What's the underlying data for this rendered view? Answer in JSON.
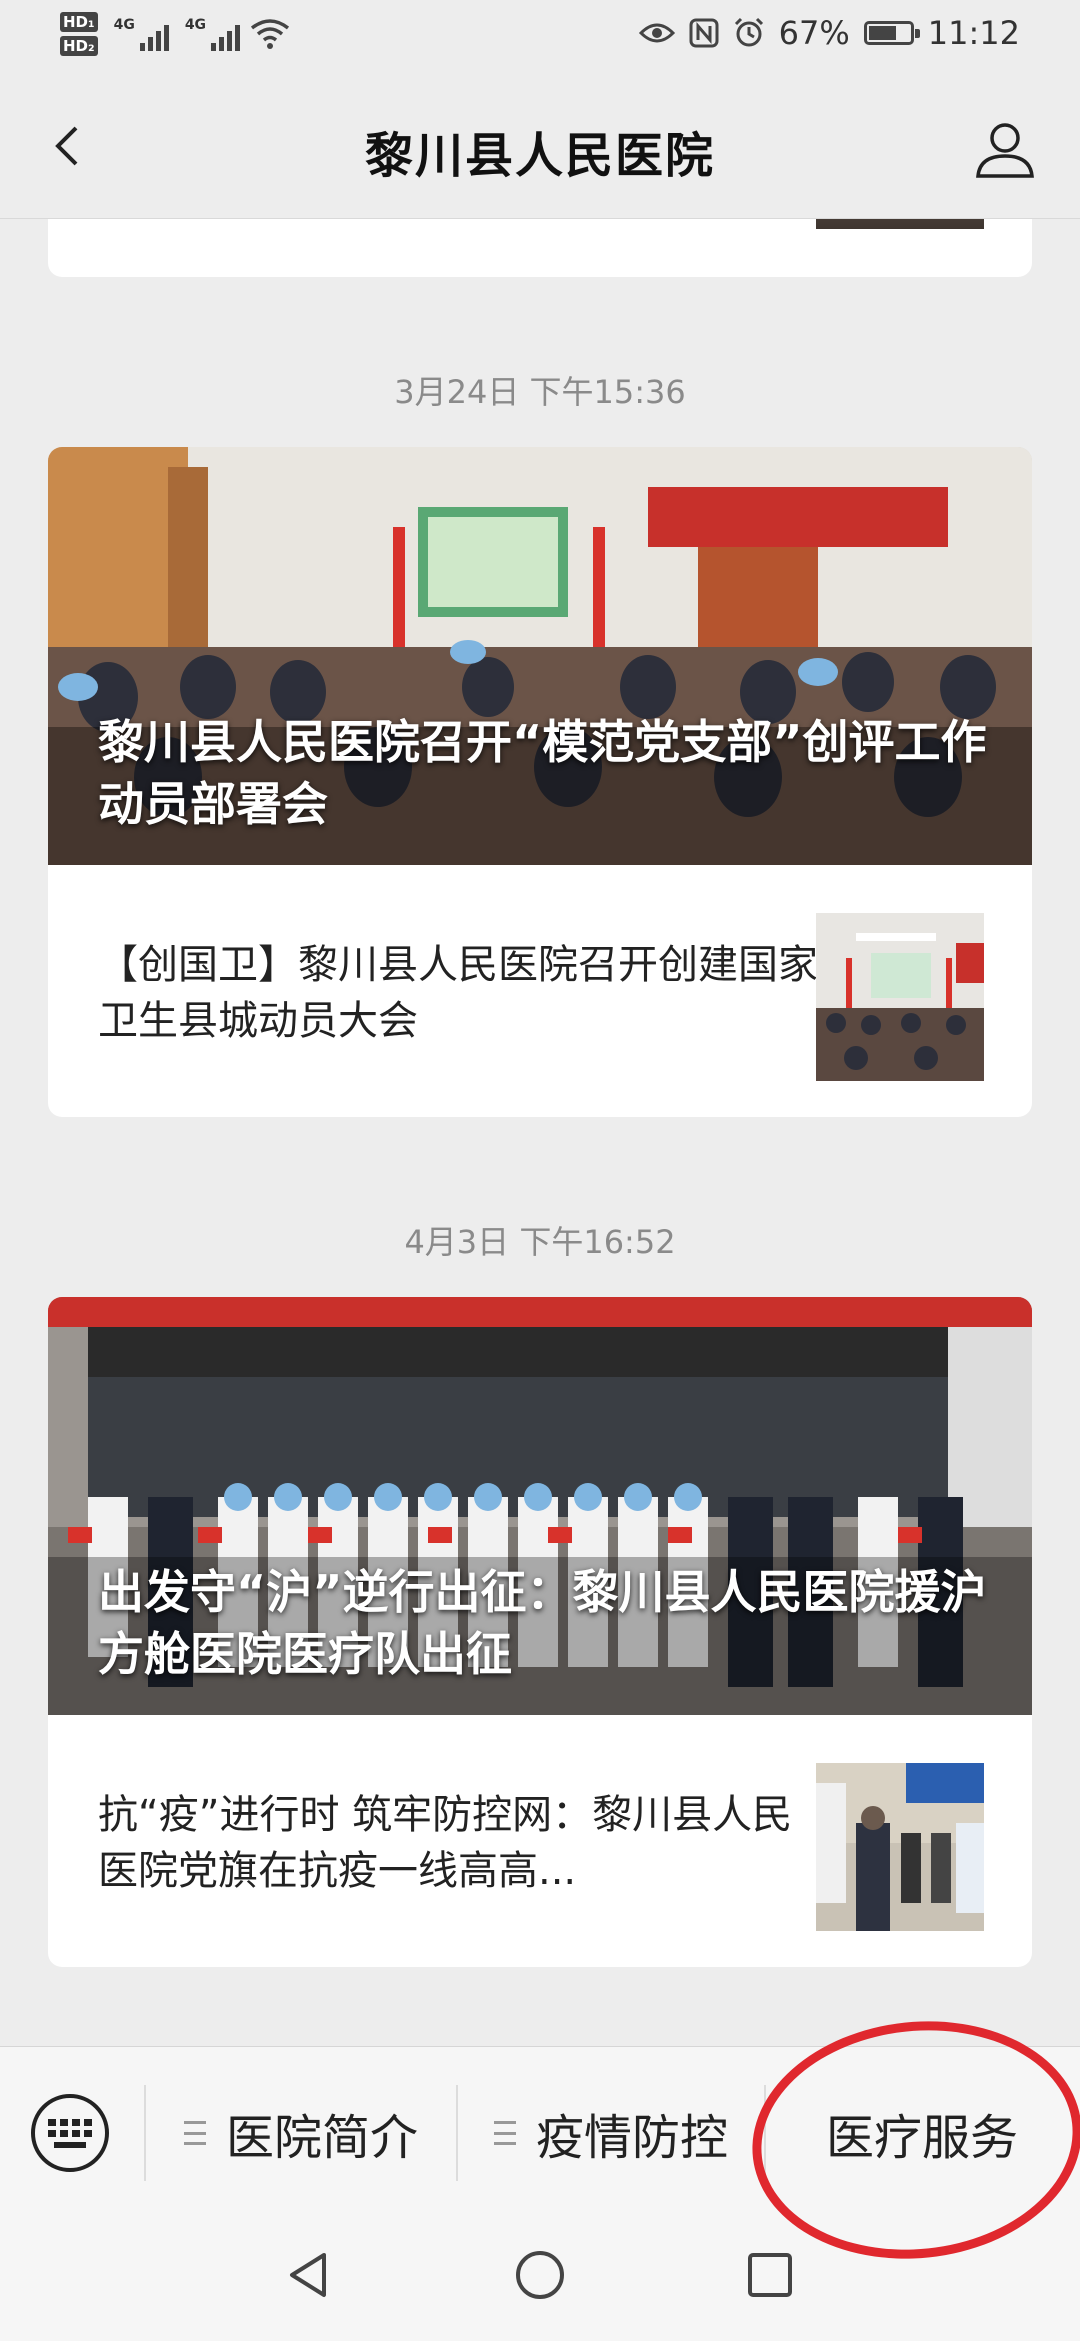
{
  "status_bar": {
    "hd1": "HD₁",
    "hd2": "HD₂",
    "net1": "4G",
    "net2": "4G",
    "battery_pct": "67%",
    "battery_level": 0.67,
    "time": "11:12",
    "icons": [
      "eye-icon",
      "nfc-icon",
      "alarm-icon",
      "battery-icon",
      "wifi-icon"
    ]
  },
  "header": {
    "title": "黎川县人民医院",
    "back_icon": "back-arrow-icon",
    "profile_icon": "user-profile-icon"
  },
  "feed": [
    {
      "time": "3月24日 下午15:36",
      "banner_title": "黎川县人民医院召开“模范党支部”创评工作动员部署会",
      "sub_title": "【创国卫】黎川县人民医院召开创建国家卫生县城动员大会"
    },
    {
      "time": "4月3日 下午16:52",
      "banner_title": "出发守“沪”逆行出征：黎川县人民医院援沪方舱医院医疗队出征",
      "sub_title": "抗“疫”进行时 筑牢防控网：黎川县人民医院党旗在抗疫一线高高..."
    }
  ],
  "menu": {
    "keyboard_icon": "keyboard-icon",
    "items": [
      "医院简介",
      "疫情防控",
      "医疗服务"
    ]
  },
  "colors": {
    "background": "#ededed",
    "card": "#ffffff",
    "annotation_circle": "#e0282e"
  }
}
